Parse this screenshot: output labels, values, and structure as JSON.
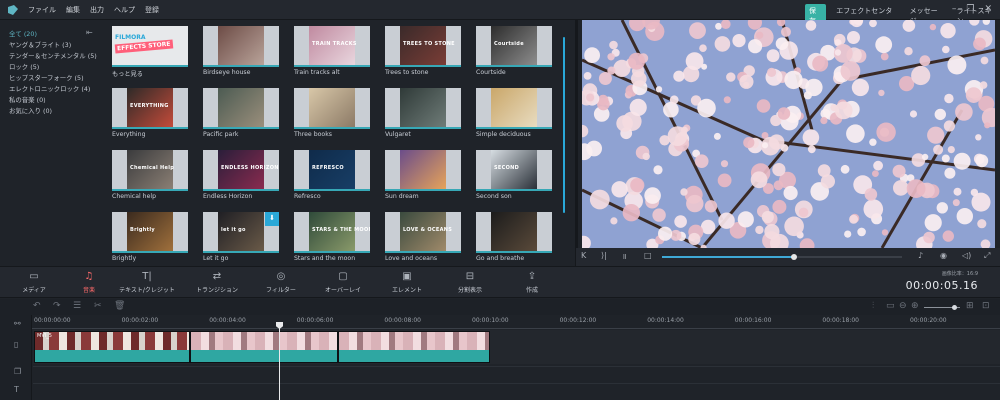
{
  "menu": [
    "ファイル",
    "編集",
    "出力",
    "ヘルプ",
    "登録"
  ],
  "modes": {
    "items": [
      "保存",
      "エフェクトセンター",
      "メッセージ",
      "ライトスキン"
    ],
    "active_index": 0
  },
  "window_controls": [
    "minimize-icon",
    "restore-icon",
    "close-icon"
  ],
  "categories": [
    {
      "label": "全て (20)",
      "active": true
    },
    {
      "label": "ヤング＆ブライト (3)"
    },
    {
      "label": "テンダー＆センチメンタル (5)"
    },
    {
      "label": "ロック (5)"
    },
    {
      "label": "ヒップスターフォーク (5)"
    },
    {
      "label": "エレクトロニックロック (4)"
    },
    {
      "label": "私の音楽 (0)"
    },
    {
      "label": "お気に入り (0)"
    }
  ],
  "templates": [
    {
      "label": "もっと見る",
      "store": true,
      "store_line1": "FILMORA",
      "store_line2": "EFFECTS STORE"
    },
    {
      "label": "Birdseye house",
      "c1": "#6d4c46",
      "c2": "#b9a39a"
    },
    {
      "label": "Train tracks alt",
      "c1": "#c08aa0",
      "c2": "#e9d6de",
      "ovl": "TRAIN TRACKS"
    },
    {
      "label": "Trees to stone",
      "c1": "#3a2a2a",
      "c2": "#7a3d36",
      "ovl": "TREES TO STONE"
    },
    {
      "label": "Courtside",
      "c1": "#2d2d2d",
      "c2": "#8d8d8d",
      "ovl": "Courtside"
    },
    {
      "label": "Everything",
      "c1": "#2e2a28",
      "c2": "#c44b3a",
      "ovl": "EVERYTHING"
    },
    {
      "label": "Pacific park",
      "c1": "#4c5b52",
      "c2": "#9b8f7c"
    },
    {
      "label": "Three books",
      "c1": "#d8c7a8",
      "c2": "#8c7a66"
    },
    {
      "label": "Vulgaret",
      "c1": "#2f3a38",
      "c2": "#6f7c78"
    },
    {
      "label": "Simple deciduous",
      "c1": "#caa76a",
      "c2": "#e8dcc0"
    },
    {
      "label": "Chemical help",
      "c1": "#3a3b3d",
      "c2": "#8b7f74",
      "ovl": "Chemical Help"
    },
    {
      "label": "Endless Horizon",
      "c1": "#2a1e3a",
      "c2": "#8a2b4f",
      "ovl": "ENDLESS HORIZON"
    },
    {
      "label": "Refresco",
      "c1": "#0f2b4a",
      "c2": "#183e66",
      "ovl": "REFRESCO"
    },
    {
      "label": "Sun dream",
      "c1": "#6b4d8a",
      "c2": "#e6a35a"
    },
    {
      "label": "Second son",
      "c1": "#d6dde2",
      "c2": "#2a3038",
      "ovl": "SECOND"
    },
    {
      "label": "Brightly",
      "c1": "#3a2a1e",
      "c2": "#a0703c",
      "ovl": "Brightly"
    },
    {
      "label": "Let it go",
      "c1": "#1f1f24",
      "c2": "#6a5a48",
      "ovl": "let it go",
      "download": true
    },
    {
      "label": "Stars and the moon",
      "c1": "#2f4a3a",
      "c2": "#8a9a6a",
      "ovl": "STARS & THE MOON"
    },
    {
      "label": "Love and oceans",
      "c1": "#3a4a3e",
      "c2": "#a08a6a",
      "ovl": "LOVE & OCEANS"
    },
    {
      "label": "Go and breathe",
      "c1": "#1c1c1c",
      "c2": "#5a4a3a"
    }
  ],
  "preview": {
    "controls": [
      "skip-back-icon",
      "skip-forward-icon",
      "pause-icon",
      "stop-icon"
    ],
    "right_controls": [
      "volume-icon",
      "snapshot-icon",
      "speaker-icon",
      "fullscreen-icon"
    ],
    "progress": 0.55
  },
  "toolbar": {
    "items": [
      {
        "label": "メディア",
        "icon": "folder-icon",
        "glyph": "▭"
      },
      {
        "label": "音楽",
        "icon": "music-icon",
        "glyph": "♫",
        "active": true
      },
      {
        "label": "テキスト/クレジット",
        "icon": "text-icon",
        "glyph": "T|"
      },
      {
        "label": "トランジション",
        "icon": "transition-icon",
        "glyph": "⇄"
      },
      {
        "label": "フィルター",
        "icon": "filter-icon",
        "glyph": "◎"
      },
      {
        "label": "オーバーレイ",
        "icon": "overlay-icon",
        "glyph": "▢"
      },
      {
        "label": "エレメント",
        "icon": "element-icon",
        "glyph": "▣"
      },
      {
        "label": "分割表示",
        "icon": "split-screen-icon",
        "glyph": "⊟"
      },
      {
        "label": "作成",
        "icon": "export-icon",
        "glyph": "⇪"
      }
    ],
    "frame_rate_label": "画像比率：16:9",
    "timecode": "00:00:05.16"
  },
  "timeline": {
    "tools": [
      "undo-icon",
      "redo-icon",
      "adjust-icon",
      "cut-icon",
      "delete-icon"
    ],
    "right_tools": [
      "audio-wave-icon",
      "fit-icon",
      "zoom-out-icon",
      "zoom-in-icon"
    ],
    "ticks": [
      "00:00:00:00",
      "00:00:02:00",
      "00:00:04:00",
      "00:00:06:00",
      "00:00:08:00",
      "00:00:10:00",
      "00:00:12:00",
      "00:00:14:00",
      "00:00:16:00",
      "00:00:18:00",
      "00:00:20:00"
    ],
    "clips": [
      {
        "name": "MVI_5",
        "scheme": "red"
      },
      {
        "name": "",
        "scheme": "pink"
      },
      {
        "name": "",
        "scheme": "pink"
      }
    ],
    "left_tools": [
      "link-icon",
      "video-track-icon",
      "copy-track-icon",
      "text-track-icon"
    ]
  }
}
